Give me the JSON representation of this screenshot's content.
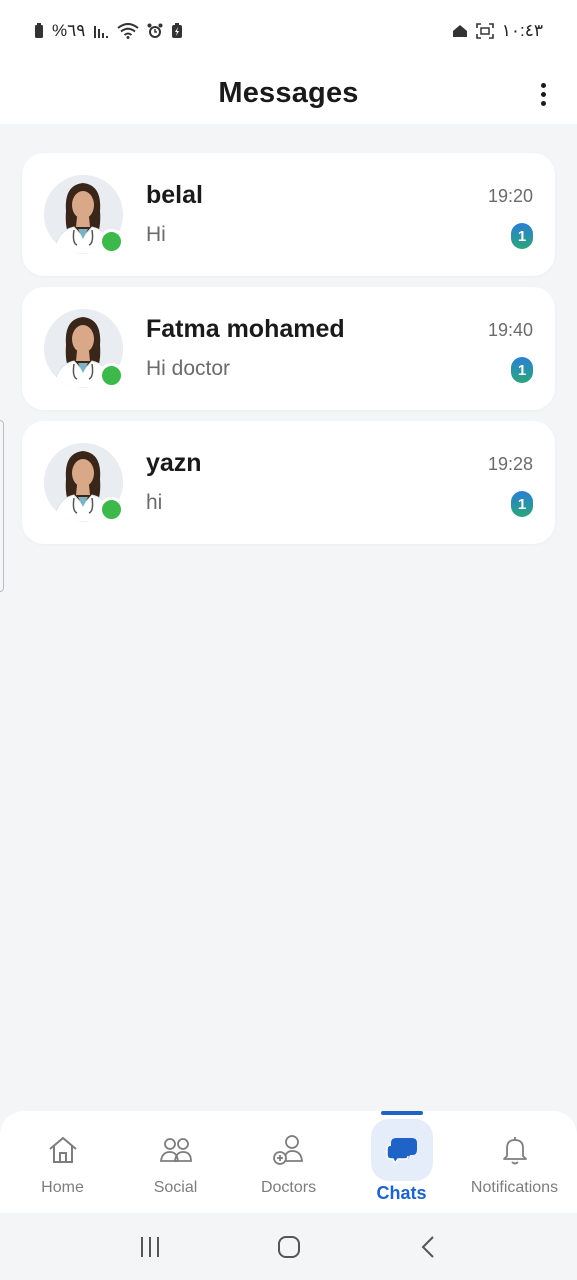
{
  "status_bar": {
    "left_text": "%٦٩",
    "time": "١٠:٤٣"
  },
  "header": {
    "title": "Messages",
    "more_icon": "more-vertical-icon"
  },
  "chats": [
    {
      "name": "belal",
      "preview": "Hi",
      "time": "19:20",
      "unread": "1",
      "online": true
    },
    {
      "name": "Fatma mohamed",
      "preview": "Hi doctor",
      "time": "19:40",
      "unread": "1",
      "online": true
    },
    {
      "name": "yazn",
      "preview": "hi",
      "time": "19:28",
      "unread": "1",
      "online": true
    }
  ],
  "bottom_nav": {
    "items": [
      {
        "label": "Home",
        "icon": "home-icon"
      },
      {
        "label": "Social",
        "icon": "people-icon"
      },
      {
        "label": "Doctors",
        "icon": "add-person-icon"
      },
      {
        "label": "Chats",
        "icon": "chat-bubbles-icon",
        "active": true
      },
      {
        "label": "Notifications",
        "icon": "bell-icon"
      }
    ]
  },
  "colors": {
    "accent": "#1f63c6",
    "online": "#3cb94a",
    "badge_top": "#2b7fd4",
    "badge_bottom": "#2aa57a",
    "background": "#f4f5f7"
  }
}
